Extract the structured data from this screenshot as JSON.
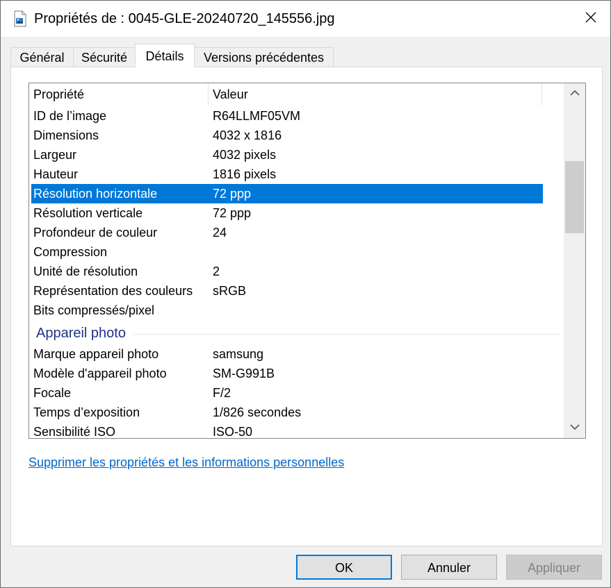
{
  "window": {
    "title": "Propriétés de : 0045-GLE-20240720_145556.jpg",
    "title_icon": "image-file-icon",
    "close_icon": "close-icon"
  },
  "tabs": [
    {
      "label": "Général",
      "active": false
    },
    {
      "label": "Sécurité",
      "active": false
    },
    {
      "label": "Détails",
      "active": true
    },
    {
      "label": "Versions précédentes",
      "active": false
    }
  ],
  "list": {
    "columns": [
      "Propriété",
      "Valeur"
    ],
    "image_rows": [
      {
        "property": "ID de l’image",
        "value": "R64LLMF05VM"
      },
      {
        "property": "Dimensions",
        "value": "4032 x 1816"
      },
      {
        "property": "Largeur",
        "value": "4032 pixels"
      },
      {
        "property": "Hauteur",
        "value": "1816 pixels"
      },
      {
        "property": "Résolution horizontale",
        "value": "72 ppp",
        "selected": true
      },
      {
        "property": "Résolution verticale",
        "value": "72 ppp"
      },
      {
        "property": "Profondeur de couleur",
        "value": "24"
      },
      {
        "property": "Compression",
        "value": ""
      },
      {
        "property": "Unité de résolution",
        "value": "2"
      },
      {
        "property": "Représentation des couleurs",
        "value": "sRGB"
      },
      {
        "property": "Bits compressés/pixel",
        "value": ""
      }
    ],
    "group_camera": "Appareil photo",
    "camera_rows": [
      {
        "property": "Marque appareil photo",
        "value": "samsung"
      },
      {
        "property": "Modèle d'appareil photo",
        "value": "SM-G991B"
      },
      {
        "property": "Focale",
        "value": "F/2"
      },
      {
        "property": "Temps d’exposition",
        "value": "1/826 secondes"
      },
      {
        "property": "Sensibilité ISO",
        "value": "ISO-50"
      }
    ]
  },
  "remove_link": "Supprimer les propriétés et les informations personnelles",
  "buttons": {
    "ok": "OK",
    "cancel": "Annuler",
    "apply": "Appliquer"
  },
  "colors": {
    "selection": "#0078d7",
    "group_heading": "#1e3287",
    "link": "#0066cc"
  }
}
